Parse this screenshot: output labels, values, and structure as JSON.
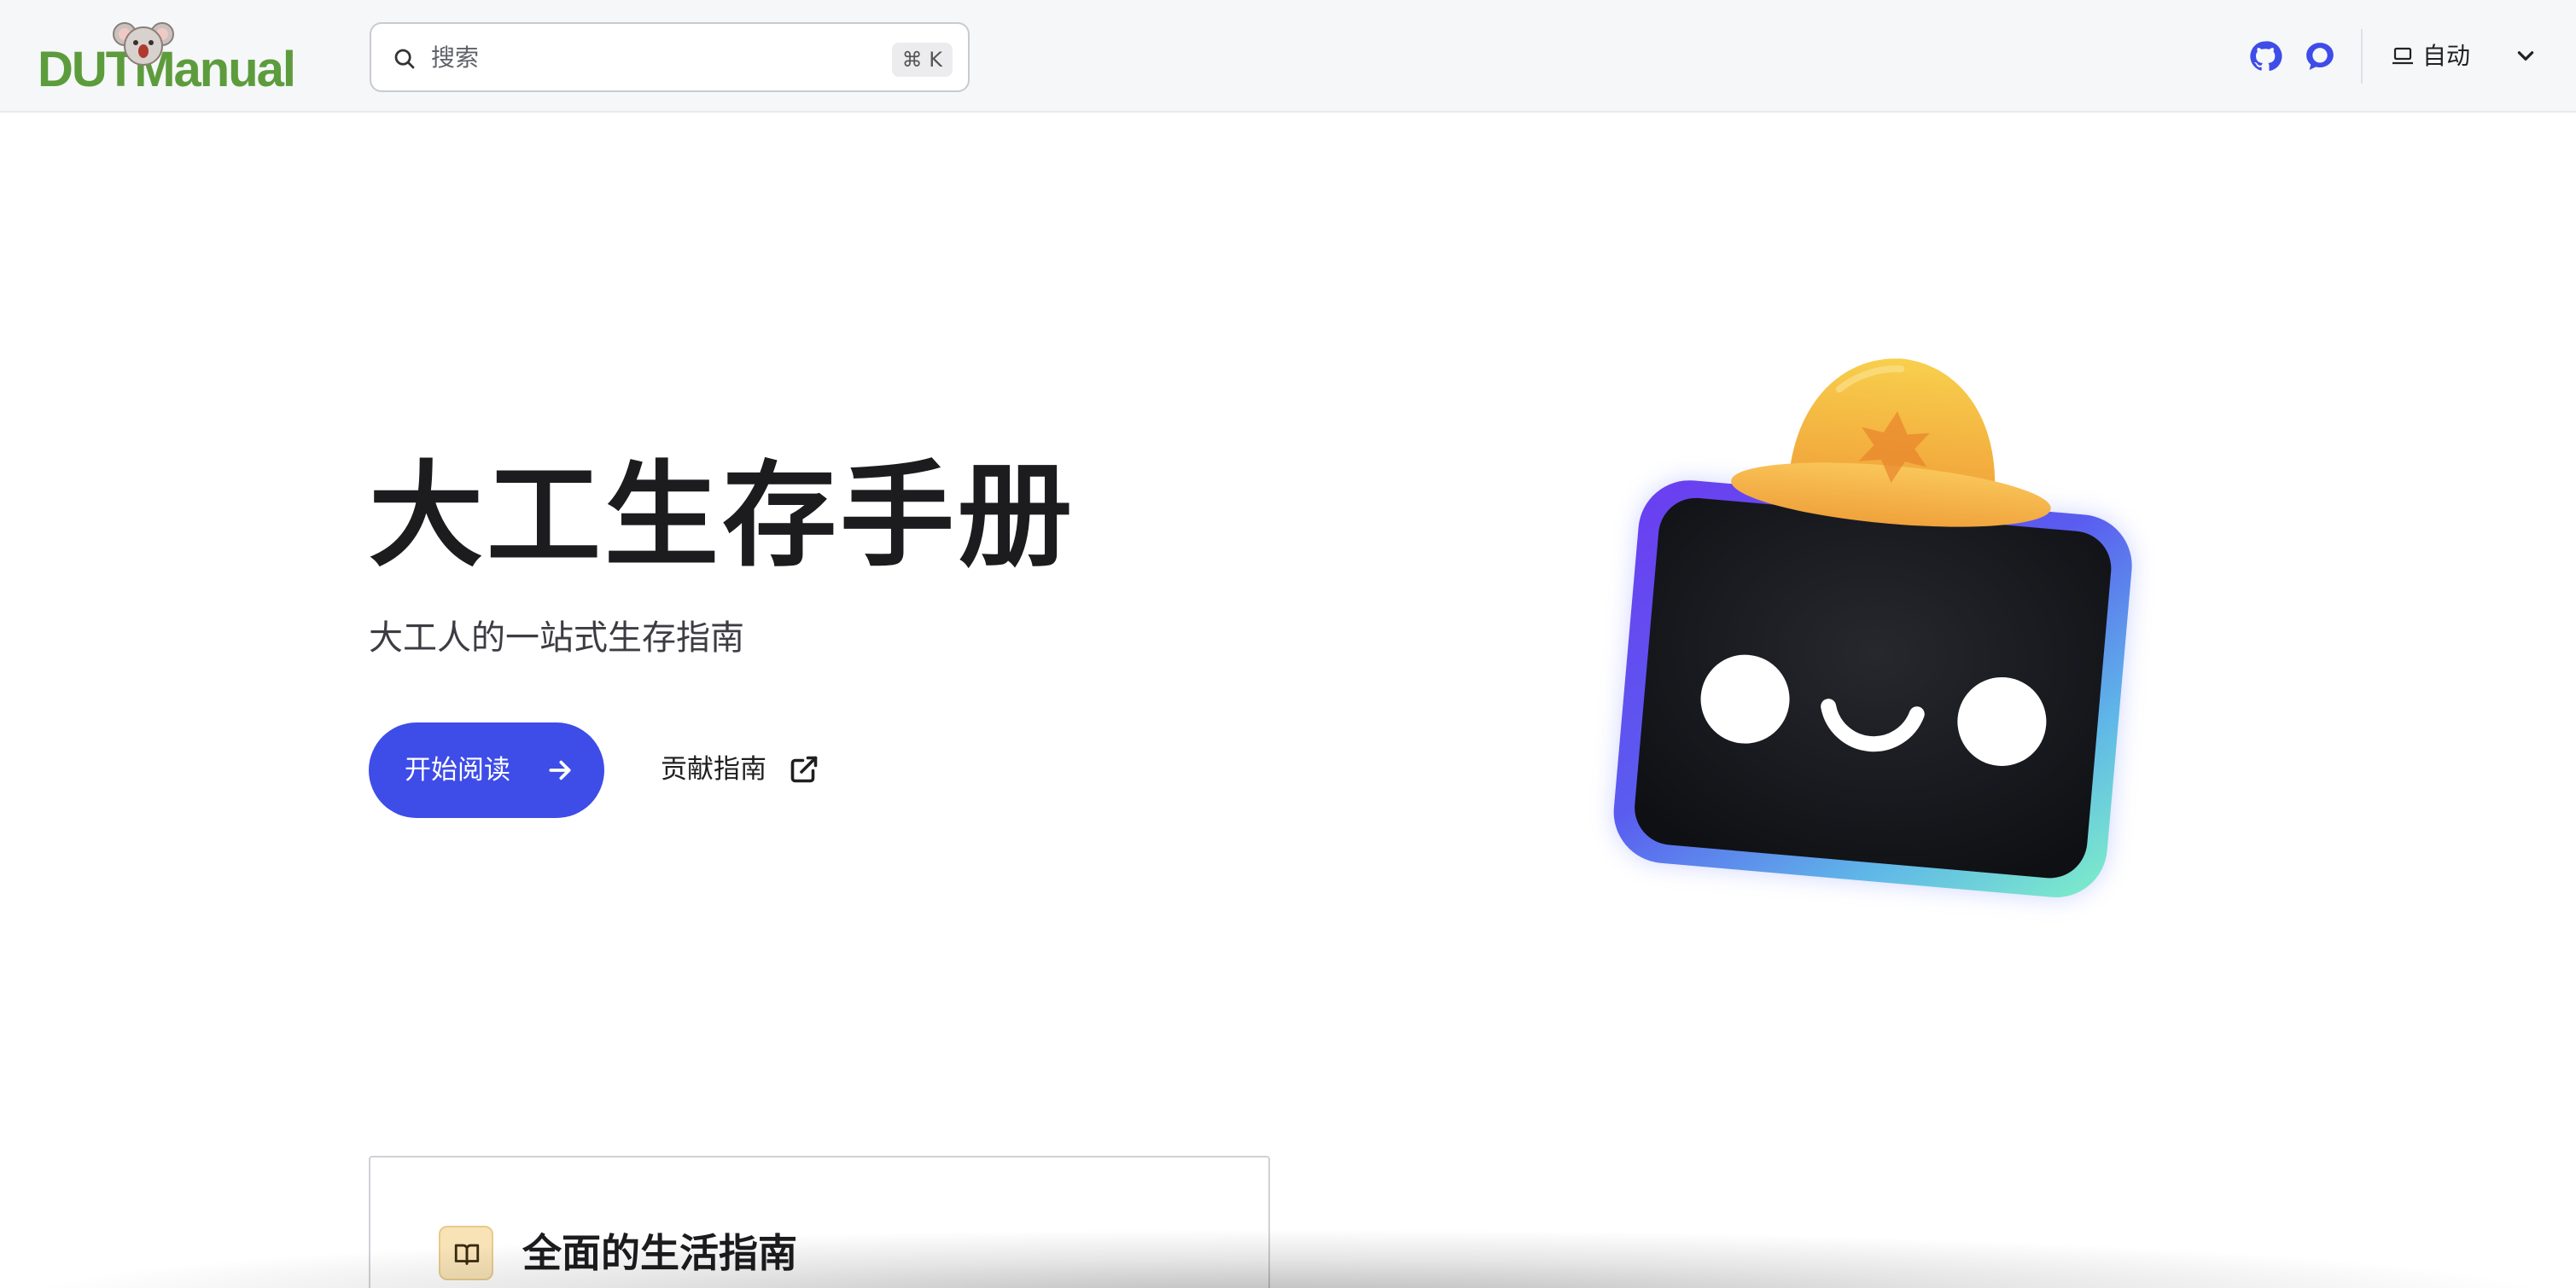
{
  "header": {
    "logo_text": "DUTManual",
    "search": {
      "placeholder": "搜索",
      "shortcut": "⌘ K"
    },
    "theme": {
      "label": "自动"
    },
    "icons": [
      "github-icon",
      "discord-icon",
      "laptop-icon",
      "chevron-down-icon"
    ]
  },
  "hero": {
    "title": "大工生存手册",
    "subtitle": "大工人的一站式生存指南",
    "primary_action": "开始阅读",
    "secondary_action": "贡献指南"
  },
  "features": [
    {
      "title": "全面的生活指南",
      "icon": "book-icon"
    }
  ],
  "colors": {
    "brand_green": "#5d9c3c",
    "accent_blue": "#3e4ce8",
    "hat_orange": "#f5a93a"
  }
}
